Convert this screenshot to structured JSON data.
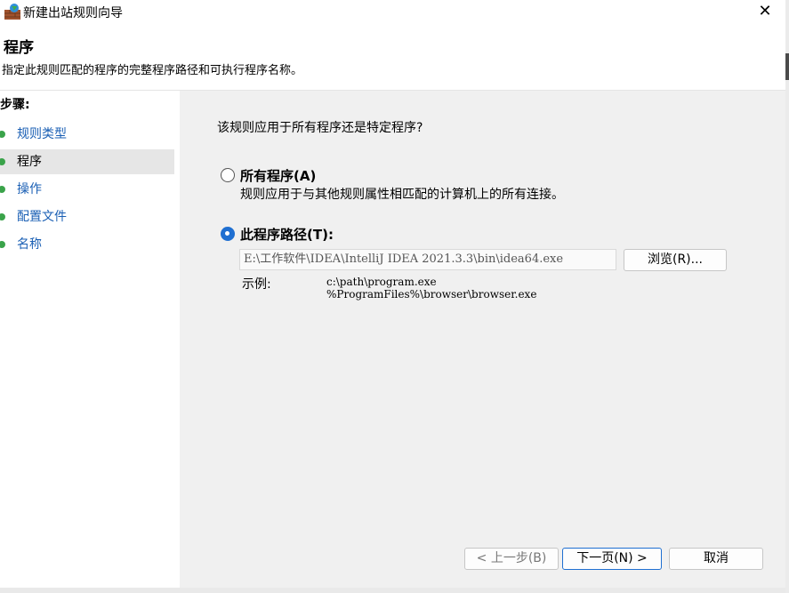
{
  "window": {
    "title": "新建出站规则向导",
    "close_glyph": "✕"
  },
  "header": {
    "title": "程序",
    "description": "指定此规则匹配的程序的完整程序路径和可执行程序名称。"
  },
  "steps": {
    "title": "步骤:",
    "items": [
      {
        "label": "规则类型",
        "state": "link"
      },
      {
        "label": "程序",
        "state": "current"
      },
      {
        "label": "操作",
        "state": "link"
      },
      {
        "label": "配置文件",
        "state": "link"
      },
      {
        "label": "名称",
        "state": "link"
      }
    ]
  },
  "main": {
    "question": "该规则应用于所有程序还是特定程序?",
    "option_all": {
      "label": "所有程序(A)",
      "description": "规则应用于与其他规则属性相匹配的计算机上的所有连接。",
      "selected": false
    },
    "option_path": {
      "label": "此程序路径(T):",
      "selected": true,
      "value": "E:\\工作软件\\IDEA\\IntelliJ IDEA 2021.3.3\\bin\\idea64.exe",
      "browse_label": "浏览(R)..."
    },
    "example": {
      "label": "示例:",
      "text": "c:\\path\\program.exe\n%ProgramFiles%\\browser\\browser.exe"
    }
  },
  "footer": {
    "back_label": "< 上一步(B)",
    "next_label": "下一页(N) >",
    "cancel_label": "取消"
  },
  "colors": {
    "accent": "#1f6fd1",
    "link": "#1a5fb4",
    "step_dot": "#3aa34a",
    "panel": "#f0f0f0"
  },
  "icons": {
    "app": "firewall-icon",
    "close": "close-icon",
    "step": "bullet-dot-icon"
  }
}
